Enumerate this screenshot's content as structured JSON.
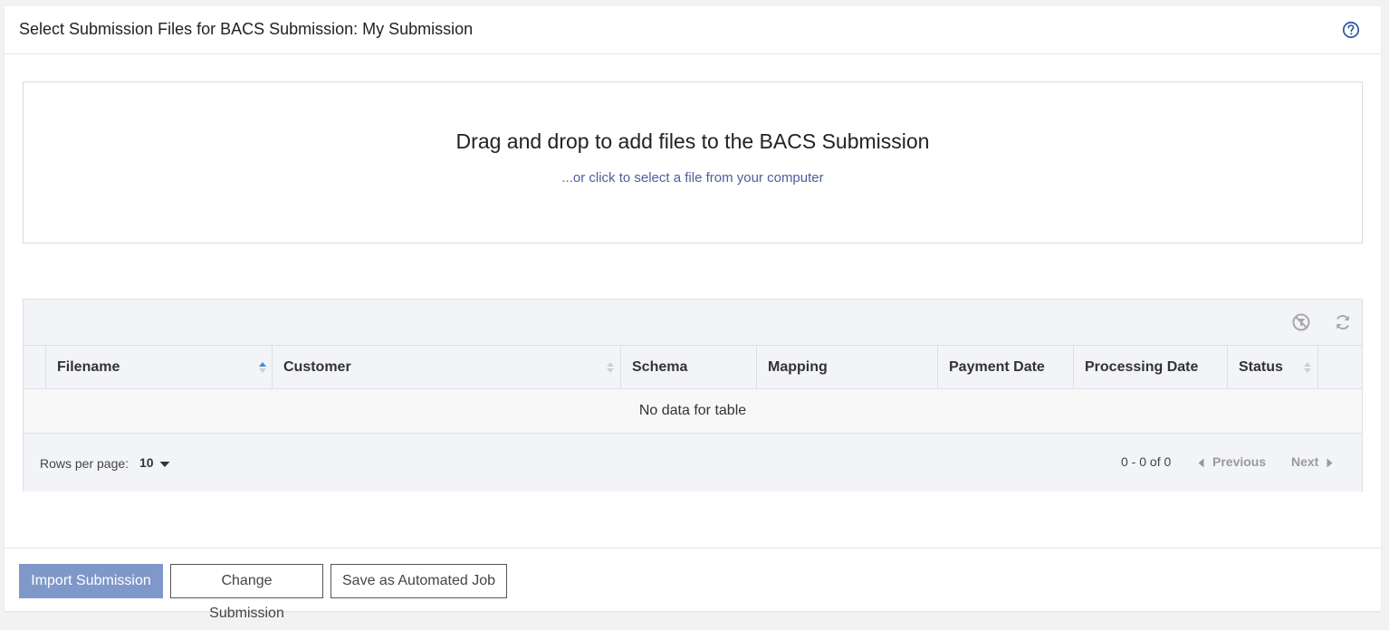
{
  "header": {
    "title": "Select Submission Files for BACS Submission: My Submission",
    "help_icon": "question-circle-icon"
  },
  "dropzone": {
    "title": "Drag and drop to add files to the BACS Submission",
    "subtitle": "...or click to select a file from your computer"
  },
  "table": {
    "toolbar_icons": [
      "clear-filter-icon",
      "refresh-icon"
    ],
    "columns": [
      {
        "label": "Filename",
        "sortable": true,
        "sorted": "asc"
      },
      {
        "label": "Customer",
        "sortable": true
      },
      {
        "label": "Schema",
        "sortable": false
      },
      {
        "label": "Mapping",
        "sortable": false
      },
      {
        "label": "Payment Date",
        "sortable": false
      },
      {
        "label": "Processing Date",
        "sortable": false
      },
      {
        "label": "Status",
        "sortable": true
      }
    ],
    "empty_text": "No data for table",
    "footer": {
      "rows_per_page_label": "Rows per page:",
      "rows_per_page_value": "10",
      "range_text": "0 - 0 of 0",
      "previous_label": "Previous",
      "next_label": "Next"
    }
  },
  "footer": {
    "import_label": "Import Submission",
    "change_label": "Change Submission",
    "save_job_label": "Save as Automated Job"
  },
  "colors": {
    "primary_button": "#7f98c9",
    "link_text": "#4d5f9c",
    "sort_active": "#3b8fe0",
    "table_bg": "#f3f4f7"
  }
}
